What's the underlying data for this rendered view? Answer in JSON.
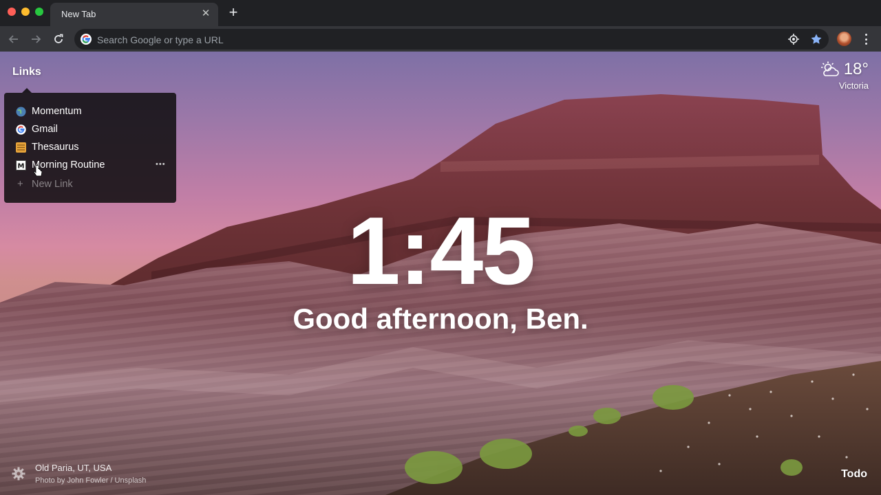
{
  "window": {
    "tab_title": "New Tab"
  },
  "toolbar": {
    "omnibox_placeholder": "Search Google or type a URL"
  },
  "icons": {
    "back": "arrow-left-icon",
    "forward": "arrow-right-icon",
    "reload": "reload-icon",
    "google": "google-g-icon",
    "location": "location-target-icon",
    "bookmark": "star-icon",
    "menu": "kebab-menu-icon",
    "settings": "gear-icon",
    "weather": "partly-cloudy-icon"
  },
  "colors": {
    "bookmark_star": "#8ab4f8",
    "panel_bg": "#121012",
    "omnibox_bg": "#202124"
  },
  "links": {
    "label": "Links",
    "items": [
      {
        "label": "Momentum",
        "icon": "momentum-globe-icon"
      },
      {
        "label": "Gmail",
        "icon": "google-icon"
      },
      {
        "label": "Thesaurus",
        "icon": "thesaurus-icon"
      },
      {
        "label": "Morning Routine",
        "icon": "medium-icon"
      }
    ],
    "new_link": "New Link"
  },
  "weather": {
    "temp": "18°",
    "location": "Victoria"
  },
  "clock": {
    "time": "1:45"
  },
  "greeting": "Good afternoon, Ben.",
  "photo": {
    "location": "Old Paria, UT, USA",
    "credit": "Photo by John Fowler / Unsplash"
  },
  "todo": "Todo"
}
